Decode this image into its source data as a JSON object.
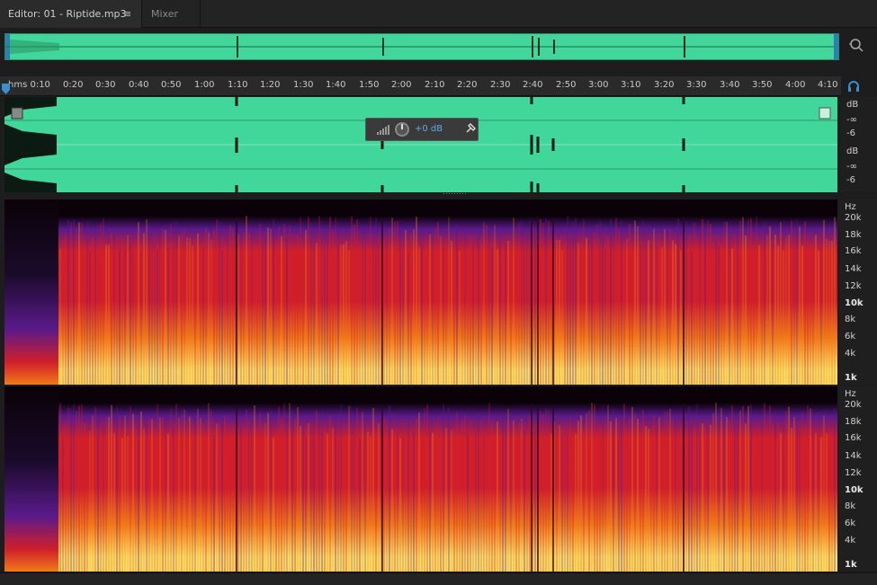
{
  "tabs": {
    "editor_label": "Editor: 01 - Riptide.mp3",
    "menu_glyph": "≡",
    "mixer_label": "Mixer"
  },
  "ruler": {
    "ticks": [
      "hms 0:10",
      "0:20",
      "0:30",
      "0:40",
      "0:50",
      "1:00",
      "1:10",
      "1:20",
      "1:30",
      "1:40",
      "1:50",
      "2:00",
      "2:10",
      "2:20",
      "2:30",
      "2:40",
      "2:50",
      "3:00",
      "3:10",
      "3:20",
      "3:30",
      "3:40",
      "3:50",
      "4:00",
      "4:10"
    ]
  },
  "waveform": {
    "color": "#41d69a",
    "volume_hud": {
      "value": "+0 dB"
    }
  },
  "db_scale": {
    "top_channel": [
      "dB",
      "-∞",
      "-6"
    ],
    "bottom_channel": [
      "dB",
      "-∞",
      "-6"
    ]
  },
  "hz_scale": {
    "labels": [
      "Hz",
      "20k",
      "18k",
      "16k",
      "14k",
      "12k",
      "10k",
      "8k",
      "6k",
      "4k",
      "1k"
    ]
  },
  "icons": {
    "zoom": "zoom-magnifier-icon",
    "loop": "headphones-icon",
    "pin": "pin-icon",
    "playhead": "playhead-marker-icon"
  },
  "colors": {
    "spectral_dark": "#0a0208",
    "spectral_purple": "#5a1a8a",
    "spectral_red": "#d01f2a",
    "spectral_orange": "#f07a1a",
    "spectral_yellow": "#ffe066",
    "accent_blue": "#2d7fb3"
  }
}
